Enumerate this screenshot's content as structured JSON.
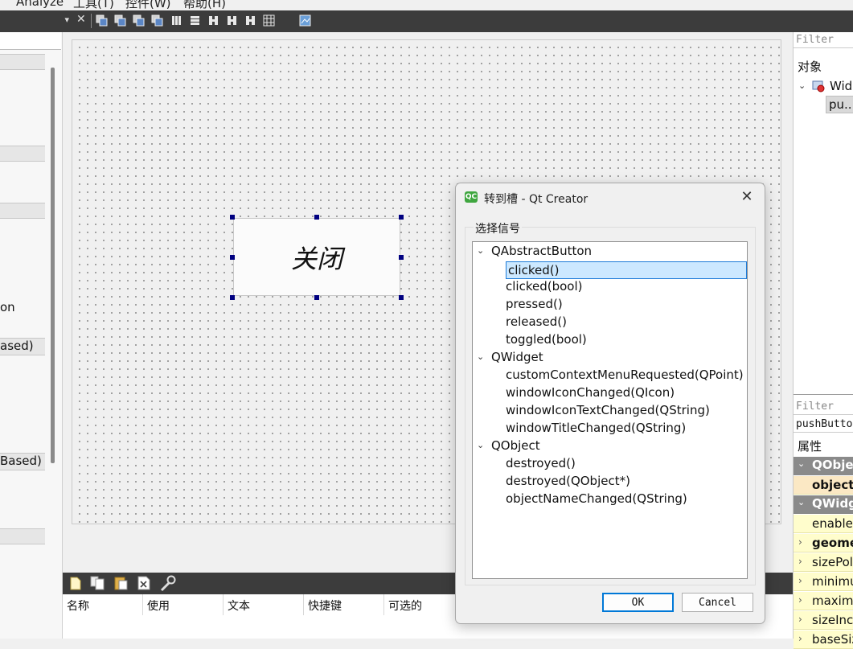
{
  "menu": {
    "items": [
      "Analyze",
      "工具(T)",
      "控件(W)",
      "帮助(H)"
    ]
  },
  "toolbar": {
    "close_glyph": "✕",
    "combo_chevron": "▾",
    "icons": [
      "send-to-back-icon",
      "bring-to-front-icon",
      "edit-signals-icon",
      "edit-tab-order-icon",
      "layout-horizontal-icon",
      "layout-vertical-icon",
      "layout-horizontal-splitter-icon",
      "layout-vertical-splitter-icon",
      "layout-form-icon",
      "layout-grid-icon",
      "break-layout-icon"
    ]
  },
  "widget_box": {
    "visible_labels": [
      "on",
      "ased)",
      "Based)"
    ]
  },
  "form": {
    "push_button_text": "关闭"
  },
  "action_editor": {
    "columns": [
      "名称",
      "使用",
      "文本",
      "快捷键",
      "可选的"
    ]
  },
  "object_inspector": {
    "filter_placeholder": "Filter",
    "header": "对象",
    "root_item": "Wid",
    "child_item": "pu..."
  },
  "property_editor": {
    "filter_placeholder": "Filter",
    "object_label": "pushButto",
    "header": "属性",
    "rows": [
      {
        "kind": "group",
        "label": "QObjec"
      },
      {
        "kind": "prop",
        "label": "objectN",
        "bold": true
      },
      {
        "kind": "group",
        "label": "QWidg"
      },
      {
        "kind": "prop",
        "label": "enabled",
        "bold": false
      },
      {
        "kind": "prop",
        "label": "geome",
        "bold": true
      },
      {
        "kind": "prop",
        "label": "sizePol",
        "bold": false
      },
      {
        "kind": "prop",
        "label": "minimu",
        "bold": false
      },
      {
        "kind": "prop",
        "label": "maximu",
        "bold": false
      },
      {
        "kind": "prop",
        "label": "sizeIncr",
        "bold": false
      },
      {
        "kind": "prop",
        "label": "baseSiz",
        "bold": false
      }
    ]
  },
  "dialog": {
    "icon_text": "QC",
    "title": "转到槽 - Qt Creator",
    "close_glyph": "✕",
    "group_title": "选择信号",
    "tree": [
      {
        "label": "QAbstractButton",
        "level": 0
      },
      {
        "label": "clicked()",
        "level": 1,
        "selected": true
      },
      {
        "label": "clicked(bool)",
        "level": 1
      },
      {
        "label": "pressed()",
        "level": 1
      },
      {
        "label": "released()",
        "level": 1
      },
      {
        "label": "toggled(bool)",
        "level": 1
      },
      {
        "label": "QWidget",
        "level": 0
      },
      {
        "label": "customContextMenuRequested(QPoint)",
        "level": 1
      },
      {
        "label": "windowIconChanged(QIcon)",
        "level": 1
      },
      {
        "label": "windowIconTextChanged(QString)",
        "level": 1
      },
      {
        "label": "windowTitleChanged(QString)",
        "level": 1
      },
      {
        "label": "QObject",
        "level": 0
      },
      {
        "label": "destroyed()",
        "level": 1
      },
      {
        "label": "destroyed(QObject*)",
        "level": 1
      },
      {
        "label": "objectNameChanged(QString)",
        "level": 1
      }
    ],
    "ok_label": "OK",
    "cancel_label": "Cancel"
  },
  "colors": {
    "selection_fill": "#cce8ff",
    "selection_border": "#1c7ad8",
    "handle": "#000080",
    "property_row": "#fffdcc",
    "property_group": "#8a8a8a",
    "toolbar": "#3c3c3c"
  }
}
